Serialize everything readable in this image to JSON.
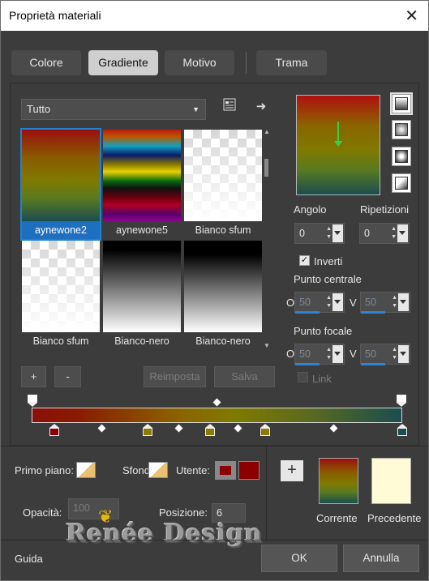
{
  "title": "Proprietà materiali",
  "tabs": [
    {
      "label": "Colore"
    },
    {
      "label": "Gradiente",
      "active": true
    },
    {
      "label": "Motivo"
    },
    {
      "label": "Trama"
    }
  ],
  "library": {
    "category": "Tutto",
    "items": [
      {
        "label": "aynewone2",
        "selected": true
      },
      {
        "label": "aynewone5"
      },
      {
        "label": "Bianco sfum"
      },
      {
        "label": "Bianco sfum"
      },
      {
        "label": "Bianco-nero"
      },
      {
        "label": "Bianco-nero"
      }
    ]
  },
  "buttons": {
    "add": "+",
    "remove": "-",
    "reset": "Reimposta",
    "save": "Salva",
    "ok": "OK",
    "cancel": "Annulla"
  },
  "settings": {
    "angle_label": "Angolo",
    "angle_value": "0",
    "repeat_label": "Ripetizioni",
    "repeat_value": "0",
    "invert_label": "Inverti",
    "invert_checked": true,
    "center_label": "Punto centrale",
    "center_h_label": "O",
    "center_h_value": "50",
    "center_v_label": "V",
    "center_v_value": "50",
    "focal_label": "Punto focale",
    "focal_h_label": "O",
    "focal_h_value": "50",
    "focal_v_label": "V",
    "focal_v_value": "50",
    "link_label": "Link"
  },
  "bottom": {
    "foreground_label": "Primo piano:",
    "background_label": "Sfondo:",
    "user_label": "Utente:",
    "user_color": "#8b0000",
    "opacity_label": "Opacità:",
    "opacity_value": "100",
    "position_label": "Posizione:",
    "position_value": "6",
    "current_label": "Corrente",
    "previous_label": "Precedente",
    "previous_color": "#fffbd7"
  },
  "watermark": "Renée Design",
  "footer": {
    "help": "Guida"
  },
  "colors": {
    "gradient_red": "#8a0f0a",
    "gradient_olive": "#7f7a00",
    "gradient_teal": "#1a4d4f",
    "accent_blue": "#1e6fc0",
    "stop_1": "#8b0000",
    "stop_2": "#8b7b00",
    "stop_3": "#8b7b00",
    "stop_4": "#8b7b00",
    "stop_5": "#1a4d4f"
  }
}
